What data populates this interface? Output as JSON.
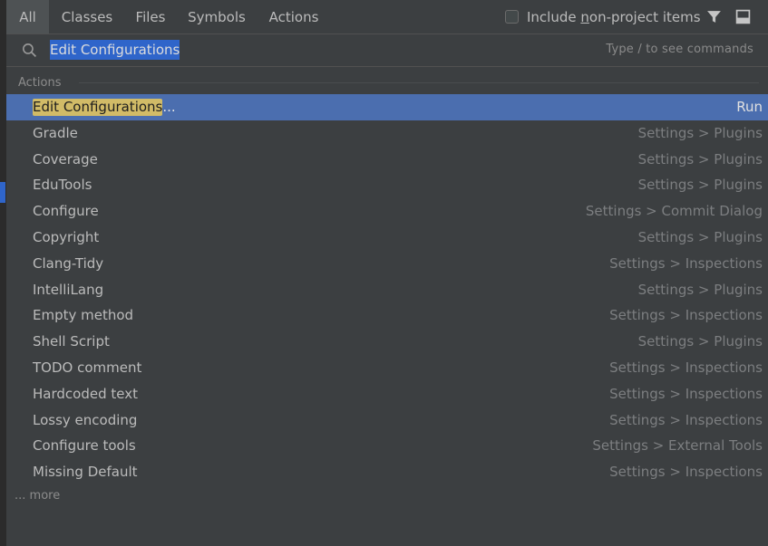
{
  "tabs": [
    {
      "label": "All"
    },
    {
      "label": "Classes"
    },
    {
      "label": "Files"
    },
    {
      "label": "Symbols"
    },
    {
      "label": "Actions"
    }
  ],
  "include": {
    "label_prefix": "Include ",
    "label_mnemonic": "n",
    "label_suffix": "on-project items",
    "checked": false
  },
  "icons": {
    "filter": "filter-icon",
    "preview": "preview-icon",
    "search": "search-icon"
  },
  "search": {
    "value": "Edit Configurations",
    "hint": "Type / to see commands"
  },
  "section": {
    "header": "Actions"
  },
  "results": [
    {
      "name_match": "Edit Configurations",
      "name_rest": "...",
      "location": "Run",
      "selected": true
    },
    {
      "name": "Gradle",
      "location": "Settings > Plugins"
    },
    {
      "name": "Coverage",
      "location": "Settings > Plugins"
    },
    {
      "name": "EduTools",
      "location": "Settings > Plugins"
    },
    {
      "name": "Configure",
      "location": "Settings > Commit Dialog"
    },
    {
      "name": "Copyright",
      "location": "Settings > Plugins"
    },
    {
      "name": "Clang-Tidy",
      "location": "Settings > Inspections"
    },
    {
      "name": "IntelliLang",
      "location": "Settings > Plugins"
    },
    {
      "name": "Empty method",
      "location": "Settings > Inspections"
    },
    {
      "name": "Shell Script",
      "location": "Settings > Plugins"
    },
    {
      "name": "TODO comment",
      "location": "Settings > Inspections"
    },
    {
      "name": "Hardcoded text",
      "location": "Settings > Inspections"
    },
    {
      "name": "Lossy encoding",
      "location": "Settings > Inspections"
    },
    {
      "name": "Configure tools",
      "location": "Settings > External Tools"
    },
    {
      "name": "Missing Default",
      "location": "Settings > Inspections"
    }
  ],
  "more_label": "... more",
  "colors": {
    "background": "#3c3f41",
    "selection": "#4b6eaf",
    "match_highlight": "#d1bb67",
    "search_selection": "#2f65ca"
  }
}
